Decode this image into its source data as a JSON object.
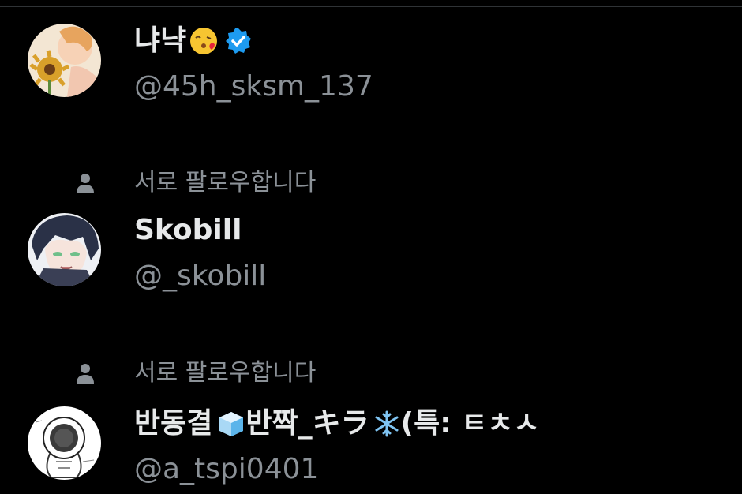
{
  "accounts": [
    {
      "follow_status": "",
      "display_name": "냐냑",
      "name_emoji": "kissing-face-icon",
      "verified": true,
      "handle": "@45h_sksm_137",
      "avatar": "avatar-sunflower-character"
    },
    {
      "follow_status": "서로 팔로우합니다",
      "display_name": "Skobill",
      "verified": false,
      "handle": "@_skobill",
      "avatar": "avatar-dark-haired-character"
    },
    {
      "follow_status": "서로 팔로우합니다",
      "display_name_part1": "반동결",
      "display_name_part2": "반짝_キラ",
      "display_name_part3": "(특: ㅌㅊㅅ",
      "name_emojis": [
        "ice-cube-icon",
        "snowflake-icon"
      ],
      "verified": false,
      "handle": "@a_tspi0401",
      "avatar": "avatar-astronaut-sketch"
    }
  ],
  "colors": {
    "background": "#000000",
    "primary_text": "#e7e9ea",
    "secondary_text": "#8b9197",
    "verified_blue": "#1d9bf0"
  }
}
